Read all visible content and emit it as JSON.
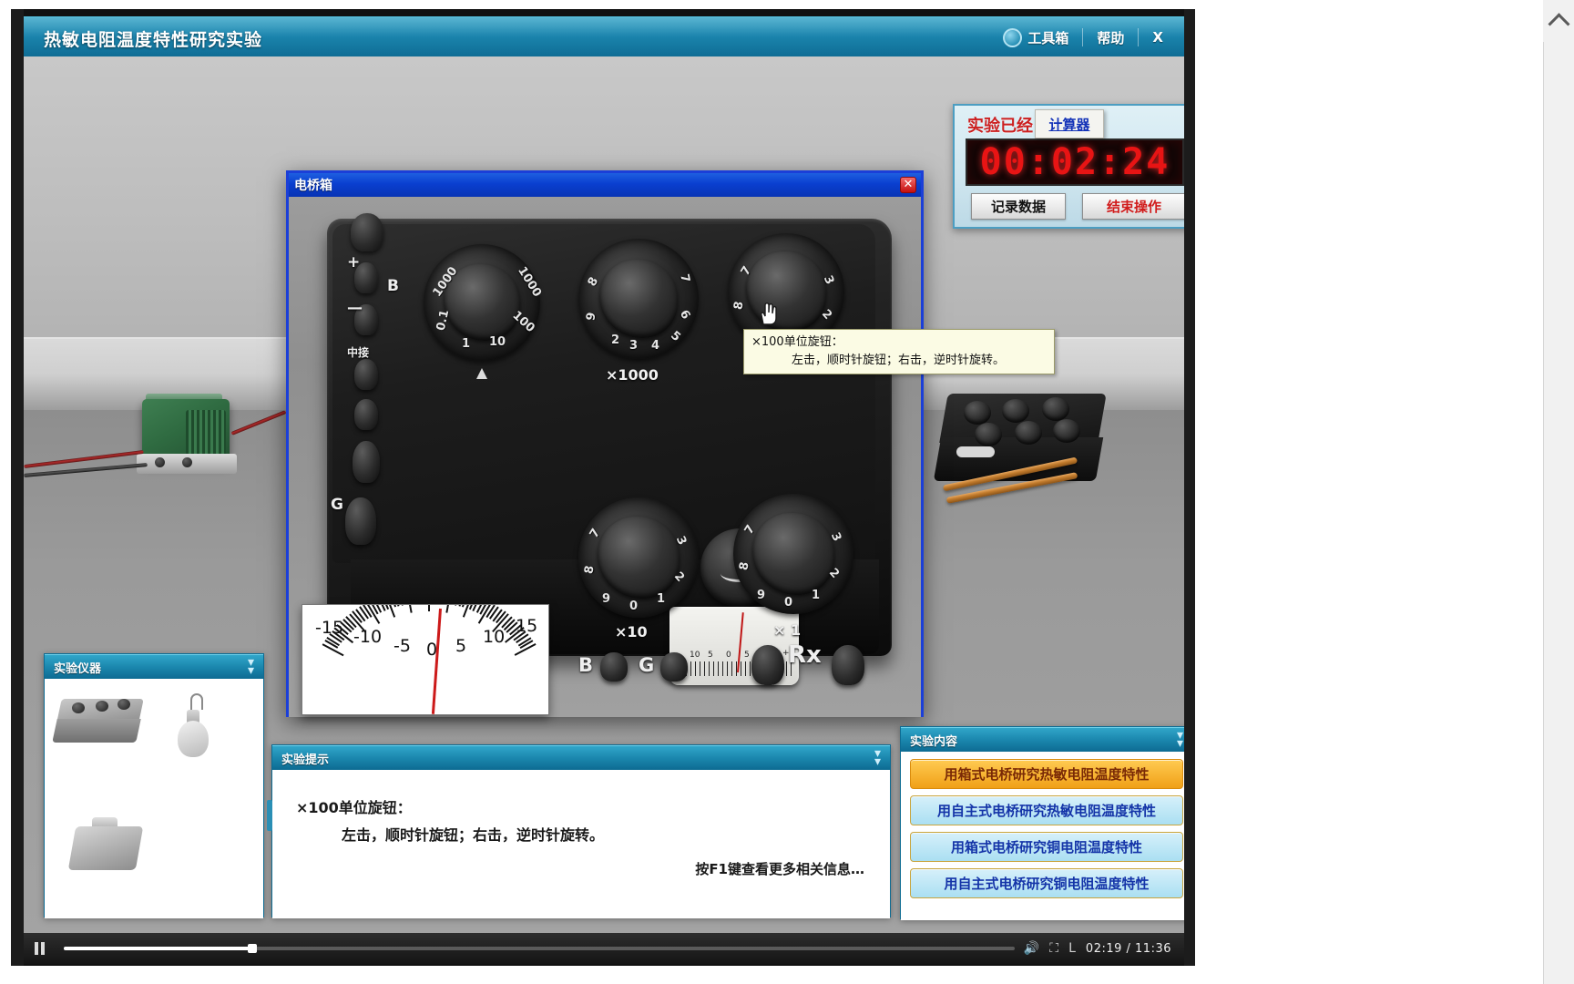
{
  "app": {
    "title": "热敏电阻温度特性研究实验",
    "toolbar": {
      "toolbox_label": "工具箱",
      "help_label": "帮助",
      "close_label": "X",
      "toolbox_icon": "toolbox-orb-icon"
    }
  },
  "timer_panel": {
    "label": "实验已经",
    "display": "00:02:24",
    "calculator_tooltip": "计算器",
    "record_button": "记录数据",
    "end_button": "结束操作"
  },
  "bridge_window": {
    "title": "电桥箱",
    "close_label": "✕",
    "dial_captions": {
      "multiplier": "×1000",
      "tens": "×10",
      "ones": "× 1",
      "rx": "Rx",
      "thousands": "×1000"
    },
    "multiplier_ticks": [
      "0.1",
      "1",
      "10",
      "100",
      "1000"
    ],
    "digit_ticks": [
      "0",
      "1",
      "2",
      "3",
      "4",
      "5",
      "6",
      "7",
      "8",
      "9"
    ],
    "terminals": [
      "B",
      "—",
      "+",
      "中接",
      "G"
    ],
    "front_labels": [
      "B",
      "G",
      "Rx"
    ],
    "galvanometer_scale": [
      "10",
      "5",
      "0",
      "5",
      "10"
    ],
    "galvanometer_signs": [
      "-",
      "+"
    ]
  },
  "galv_zoom": {
    "numbers": [
      "-15",
      "-10",
      "-5",
      "0",
      "5",
      "10",
      "15"
    ]
  },
  "knob_tooltip": {
    "line1": "×100单位旋钮：",
    "line2": "左击，顺时针旋钮；右击，逆时针旋转。"
  },
  "panels": {
    "instruments": {
      "title": "实验仪器",
      "collapse_icon": "chevron-double-down-icon"
    },
    "tips": {
      "title": "实验提示",
      "collapse_icon": "chevron-double-down-icon",
      "line1": "×100单位旋钮：",
      "line2": "左击，顺时针旋钮；右击，逆时针旋转。",
      "footer": "按F1键查看更多相关信息…"
    },
    "content": {
      "title": "实验内容",
      "collapse_icon": "chevron-double-down-icon",
      "items": [
        {
          "label": "用箱式电桥研究热敏电阻温度特性",
          "active": true
        },
        {
          "label": "用自主式电桥研究热敏电阻温度特性",
          "active": false
        },
        {
          "label": "用箱式电桥研究铜电阻温度特性",
          "active": false
        },
        {
          "label": "用自主式电桥研究铜电阻温度特性",
          "active": false
        }
      ]
    }
  },
  "player": {
    "state_icon": "pause-icon",
    "progress_percent": 19.8,
    "volume_icon": "volume-icon",
    "fullscreen_icon": "fullscreen-icon",
    "cc_icon": "L",
    "time": "02:19 / 11:36"
  },
  "scrollbar": {
    "up_icon": "chevron-up-icon"
  },
  "colors": {
    "accent": "#1b87ae",
    "window_border": "#1b3fd8",
    "timer_red": "#e81414",
    "active_item": "#f0a017"
  }
}
